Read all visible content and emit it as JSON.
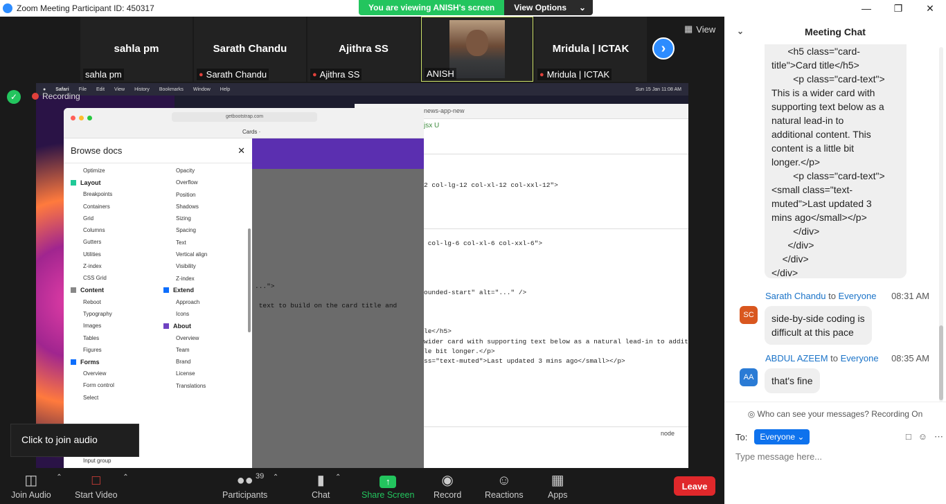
{
  "window": {
    "title": "Zoom Meeting Participant ID: 450317"
  },
  "banner": {
    "viewing": "You are viewing ANISH's screen",
    "options": "View Options"
  },
  "participants_strip": [
    {
      "name": "sahla pm",
      "label": "sahla pm",
      "muted": false
    },
    {
      "name": "Sarath Chandu",
      "label": "Sarath Chandu",
      "muted": true
    },
    {
      "name": "Ajithra SS",
      "label": "Ajithra SS",
      "muted": true
    },
    {
      "name": "",
      "label": "ANISH",
      "muted": false,
      "video": true
    },
    {
      "name": "Mridula | ICTAK",
      "label": "Mridula | ICTAK",
      "muted": true
    }
  ],
  "view_label": "View",
  "recording_label": "Recording",
  "join_audio_tip": "Click to join audio",
  "shared_screen": {
    "menubar": [
      "Safari",
      "File",
      "Edit",
      "View",
      "History",
      "Bookmarks",
      "Window",
      "Help"
    ],
    "menubar_right": "Sun 15 Jan  11:08 AM",
    "browser_url": "getbootstrap.com",
    "browser_tab": "Cards ·",
    "editor_title": "news-app-new",
    "editor_tab": "jsx U",
    "editor_terminal": "node",
    "docs_title": "Browse docs",
    "docs_col1": [
      {
        "type": "item",
        "text": "Optimize"
      },
      {
        "type": "group",
        "text": "Layout",
        "color": "#20c997"
      },
      {
        "type": "item",
        "text": "Breakpoints"
      },
      {
        "type": "item",
        "text": "Containers"
      },
      {
        "type": "item",
        "text": "Grid"
      },
      {
        "type": "item",
        "text": "Columns"
      },
      {
        "type": "item",
        "text": "Gutters"
      },
      {
        "type": "item",
        "text": "Utilities"
      },
      {
        "type": "item",
        "text": "Z-index"
      },
      {
        "type": "item",
        "text": "CSS Grid"
      },
      {
        "type": "group",
        "text": "Content",
        "color": "#888888"
      },
      {
        "type": "item",
        "text": "Reboot"
      },
      {
        "type": "item",
        "text": "Typography"
      },
      {
        "type": "item",
        "text": "Images"
      },
      {
        "type": "item",
        "text": "Tables"
      },
      {
        "type": "item",
        "text": "Figures"
      },
      {
        "type": "group",
        "text": "Forms",
        "color": "#0d6efd"
      },
      {
        "type": "item",
        "text": "Overview"
      },
      {
        "type": "item",
        "text": "Form control"
      },
      {
        "type": "item",
        "text": "Select"
      }
    ],
    "docs_col1_tail": "Input group",
    "docs_col2": [
      {
        "type": "item",
        "text": "Opacity"
      },
      {
        "type": "item",
        "text": "Overflow"
      },
      {
        "type": "item",
        "text": "Position"
      },
      {
        "type": "item",
        "text": "Shadows"
      },
      {
        "type": "item",
        "text": "Sizing"
      },
      {
        "type": "item",
        "text": "Spacing"
      },
      {
        "type": "item",
        "text": "Text"
      },
      {
        "type": "item",
        "text": "Vertical align"
      },
      {
        "type": "item",
        "text": "Visibility"
      },
      {
        "type": "item",
        "text": "Z-index"
      },
      {
        "type": "group",
        "text": "Extend",
        "color": "#0d6efd"
      },
      {
        "type": "item",
        "text": "Approach"
      },
      {
        "type": "item",
        "text": "Icons"
      },
      {
        "type": "group",
        "text": "About",
        "color": "#6f42c1"
      },
      {
        "type": "item",
        "text": "Overview"
      },
      {
        "type": "item",
        "text": "Team"
      },
      {
        "type": "item",
        "text": "Brand"
      },
      {
        "type": "item",
        "text": "License"
      },
      {
        "type": "item",
        "text": "Translations"
      }
    ],
    "code_lines": [
      "2 col-lg-12 col-xl-12 col-xxl-12\">",
      " col-lg-6 col-xl-6 col-xxl-6\">",
      "ounded-start\" alt=\"...\" />",
      "le</h5>",
      "wider card with supporting text below as a natural lead-in to additi",
      "le bit longer.</p>",
      "ss=\"text-muted\">Last updated 3 mins ago</small></p>"
    ],
    "overlay_lines": [
      "...\">",
      " text to build on the card title and"
    ]
  },
  "toolbar": {
    "join_audio": "Join Audio",
    "start_video": "Start Video",
    "participants": "Participants",
    "participants_count": "39",
    "chat": "Chat",
    "share_screen": "Share Screen",
    "record": "Record",
    "reactions": "Reactions",
    "apps": "Apps",
    "leave": "Leave"
  },
  "chat": {
    "title": "Meeting Chat",
    "first_message": "      <h5 class=\"card-\ntitle\">Card title</h5>\n        <p class=\"card-text\">\nThis is a wider card with\nsupporting text below as a\nnatural lead-in to\nadditional content. This\ncontent is a little bit\nlonger.</p>\n        <p class=\"card-text\">\n<small class=\"text-\nmuted\">Last updated 3\nmins ago</small></p>\n        </div>\n      </div>\n    </div>\n</div>",
    "messages": [
      {
        "initials": "SC",
        "avatar_color": "#d9571f",
        "sender": "Sarath Chandu",
        "to_word": "to",
        "recipient": "Everyone",
        "time": "08:31 AM",
        "text": "side-by-side coding is\ndifficult at this pace"
      },
      {
        "initials": "AA",
        "avatar_color": "#2a7bd5",
        "sender": "ABDUL AZEEM",
        "to_word": "to",
        "recipient": "Everyone",
        "time": "08:35 AM",
        "text": "that's fine"
      }
    ],
    "notice": "Who can see your messages? Recording On",
    "to_label": "To:",
    "to_value": "Everyone",
    "input_placeholder": "Type message here..."
  }
}
